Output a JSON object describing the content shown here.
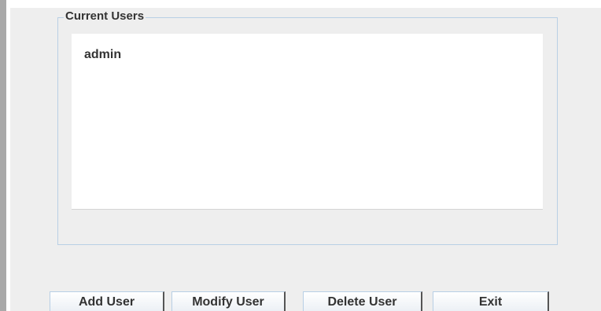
{
  "current_users": {
    "title": "Current Users",
    "items": [
      "admin"
    ]
  },
  "buttons": {
    "add_user": "Add User",
    "modify_user": "Modify User",
    "delete_user": "Delete User",
    "exit": "Exit"
  }
}
